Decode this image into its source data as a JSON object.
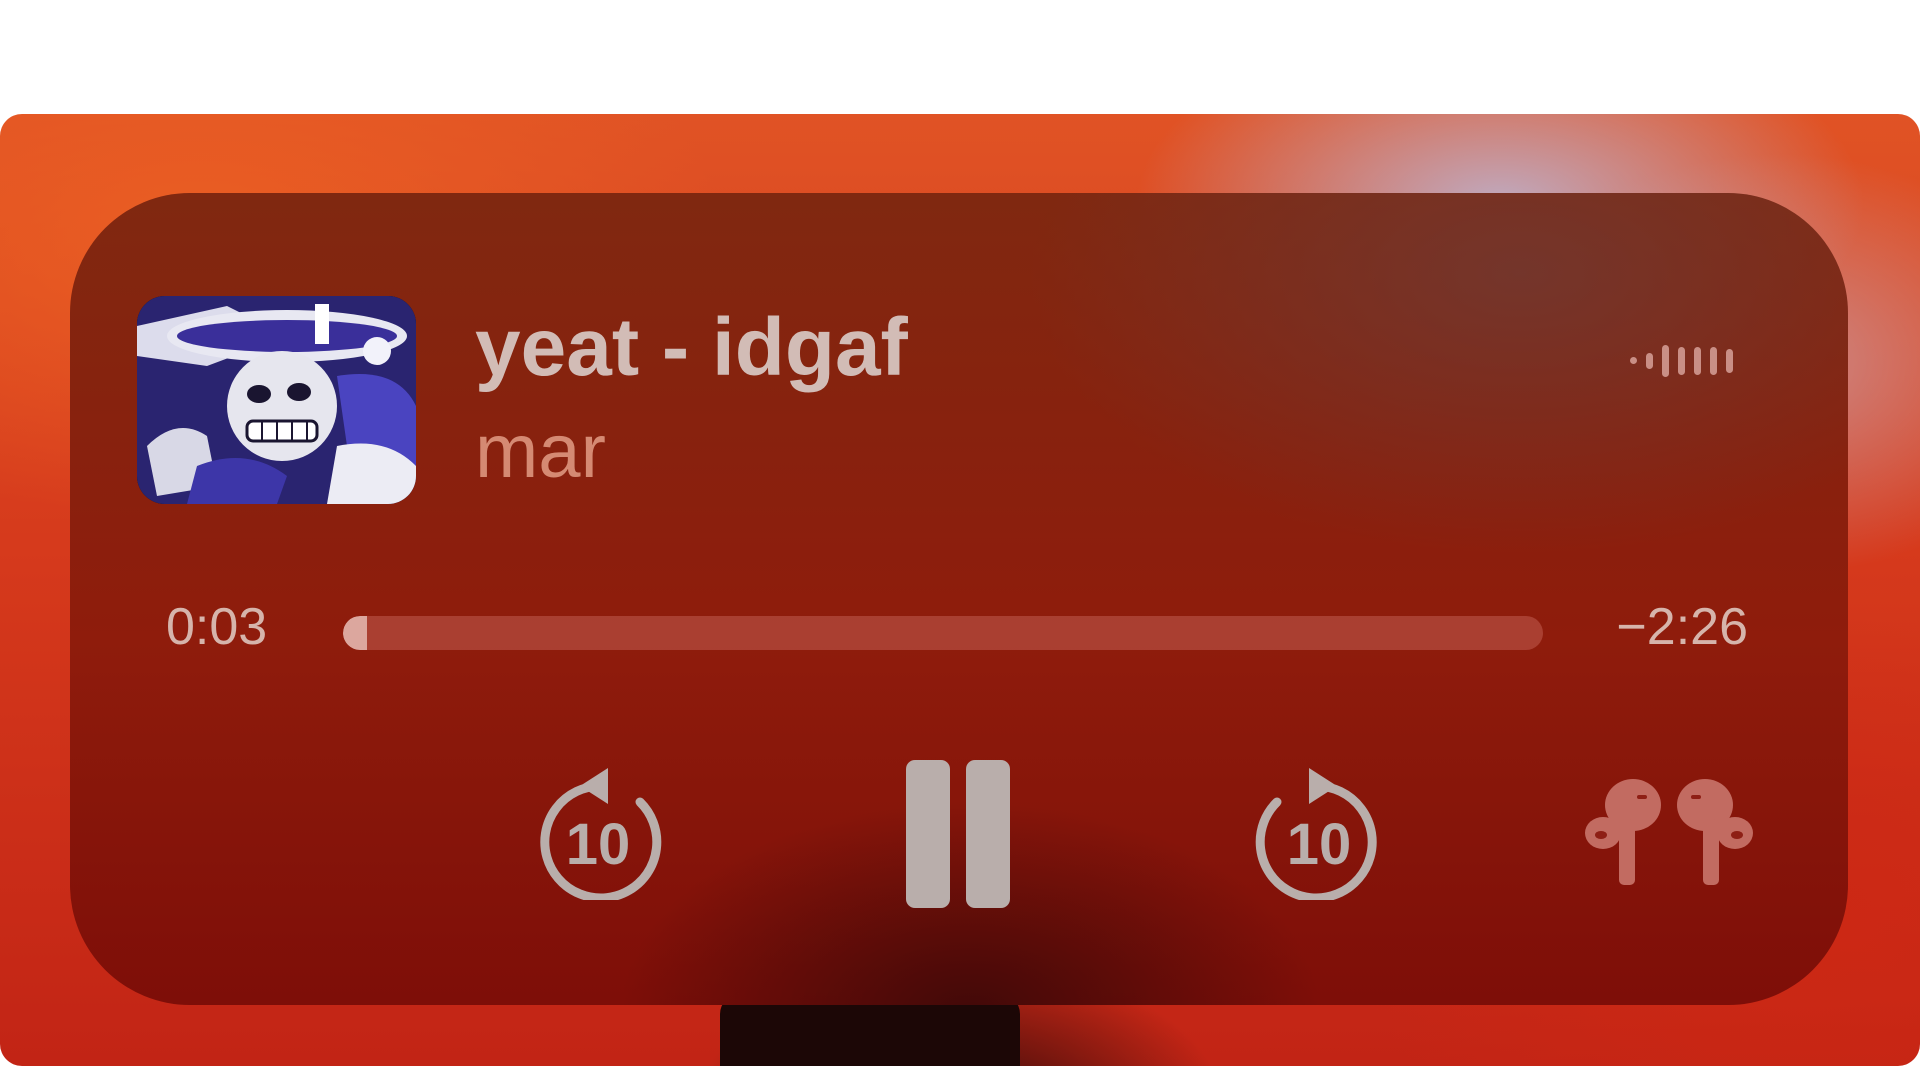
{
  "now_playing": {
    "title": "yeat - idgaf",
    "artist": "mar",
    "elapsed": "0:03",
    "remaining": "−2:26",
    "progress_fraction": 0.02
  },
  "controls": {
    "skip_back_seconds": "10",
    "skip_forward_seconds": "10"
  },
  "icons": {
    "skip_back": "gobackward-10-icon",
    "play_state": "pause-icon",
    "skip_forward": "goforward-10-icon",
    "audio_output": "airpods-pro-icon",
    "level_meter": "audio-level-meter-icon"
  },
  "colors": {
    "card_tint": "#8f1c0c",
    "title_text": "#d2bcb6",
    "artist_text": "#d58a73",
    "control_glyph": "#b9aeab",
    "progress_fill": "#dca79e"
  }
}
